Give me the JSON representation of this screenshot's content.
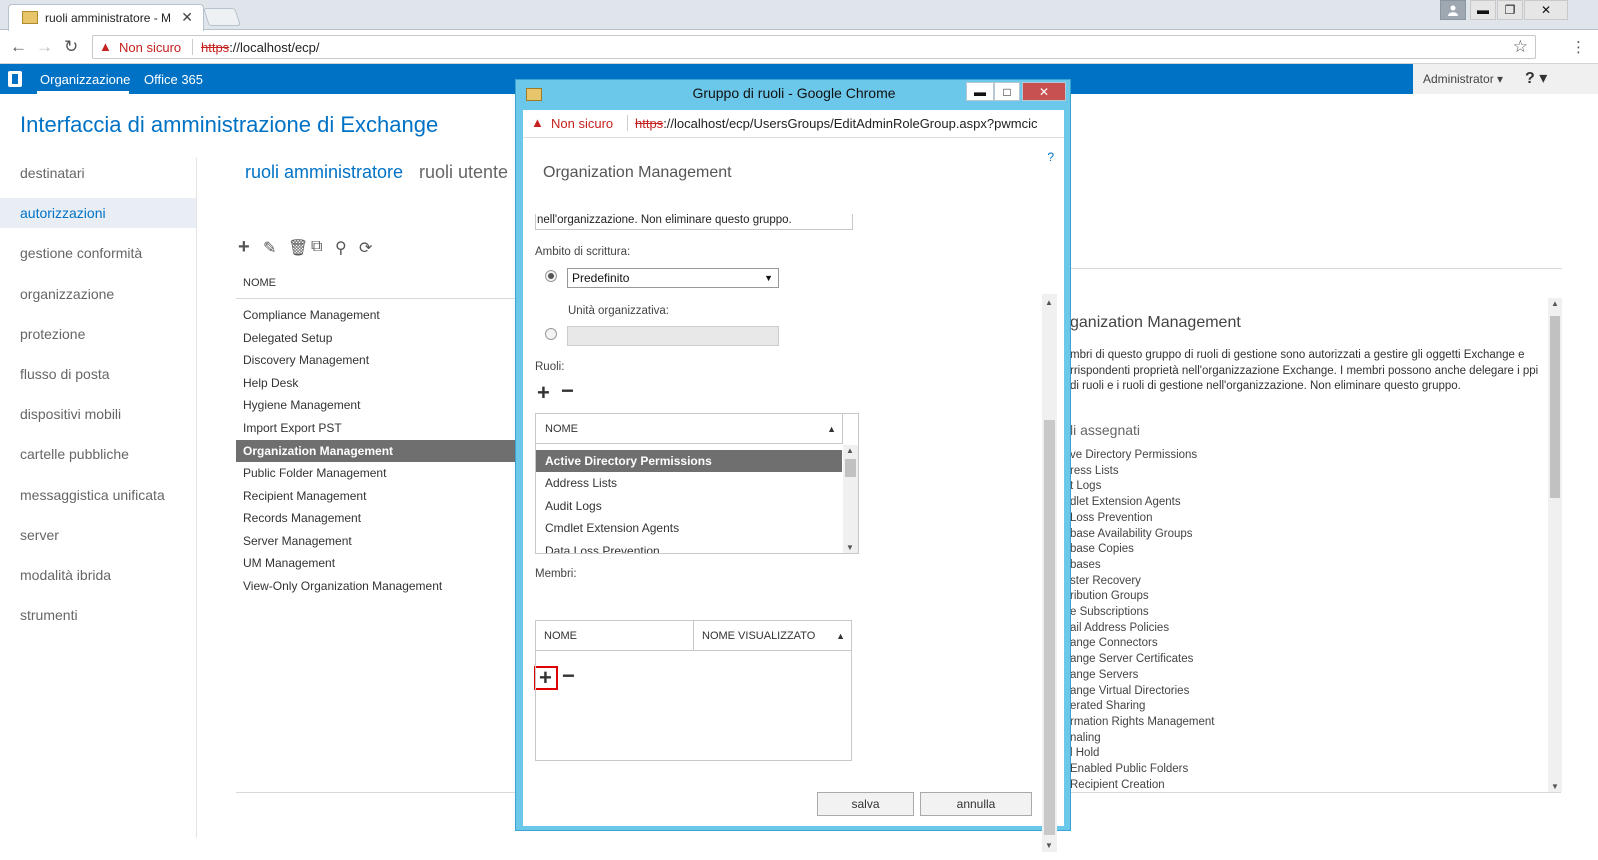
{
  "browser": {
    "tab_title": "ruoli amministratore - M",
    "tab_close": "✕",
    "security_label": "Non sicuro",
    "url_scheme": "https",
    "url_rest": "://localhost/ecp/",
    "window_buttons": [
      "▬",
      "🗗",
      "✕"
    ]
  },
  "ecp_bar": {
    "nav_organization": "Organizzazione",
    "nav_office365": "Office 365",
    "user": "Administrator ▾",
    "help": "? ▾"
  },
  "page_title": "Interfaccia di amministrazione di Exchange",
  "left_nav": [
    "destinatari",
    "autorizzazioni",
    "gestione conformità",
    "organizzazione",
    "protezione",
    "flusso di posta",
    "dispositivi mobili",
    "cartelle pubbliche",
    "messaggistica unificata",
    "server",
    "modalità ibrida",
    "strumenti"
  ],
  "subtabs": {
    "admin_roles": "ruoli amministratore",
    "user_roles": "ruoli utente"
  },
  "list": {
    "column_name": "NOME",
    "rows": [
      "Compliance Management",
      "Delegated Setup",
      "Discovery Management",
      "Help Desk",
      "Hygiene Management",
      "Import Export PST",
      "Organization Management",
      "Public Folder Management",
      "Recipient Management",
      "Records Management",
      "Server Management",
      "UM Management",
      "View-Only Organization Management"
    ],
    "selected": "Organization Management"
  },
  "details": {
    "title": "ganization Management",
    "description": "mbri di questo gruppo di ruoli di gestione sono autorizzati a gestire gli oggetti Exchange e rrispondenti proprietà nell'organizzazione Exchange. I membri possono anche delegare i ppi di ruoli e i ruoli di gestione nell'organizzazione. Non eliminare questo gruppo.",
    "roles_heading": "li assegnati",
    "roles": [
      "ve Directory Permissions",
      "ress Lists",
      "t Logs",
      "dlet Extension Agents",
      "Loss Prevention",
      "base Availability Groups",
      "base Copies",
      "bases",
      "ster Recovery",
      "ribution Groups",
      "e Subscriptions",
      "ail Address Policies",
      "ange Connectors",
      "ange Server Certificates",
      "ange Servers",
      "ange Virtual Directories",
      "erated Sharing",
      "rmation Rights Management",
      "naling",
      "l Hold",
      "Enabled Public Folders",
      "Recipient Creation"
    ]
  },
  "popup": {
    "window_title": "Gruppo di ruoli - Google Chrome",
    "security_label": "Non sicuro",
    "url_scheme": "https",
    "url_rest": "://localhost/ecp/UsersGroups/EditAdminRoleGroup.aspx?pwmcic",
    "help": "?",
    "group_name": "Organization Management",
    "description_tail": "nell'organizzazione. Non eliminare questo gruppo.",
    "write_scope_label": "Ambito di scrittura:",
    "write_scope_value": "Predefinito",
    "ou_label": "Unità organizzativa:",
    "roles_label": "Ruoli:",
    "roles_column": "NOME",
    "roles": [
      "Active Directory Permissions",
      "Address Lists",
      "Audit Logs",
      "Cmdlet Extension Agents",
      "Data Loss Prevention"
    ],
    "roles_selected": "Active Directory Permissions",
    "members_label": "Membri:",
    "members_col_name": "NOME",
    "members_col_display": "NOME VISUALIZZATO",
    "save": "salva",
    "cancel": "annulla"
  }
}
